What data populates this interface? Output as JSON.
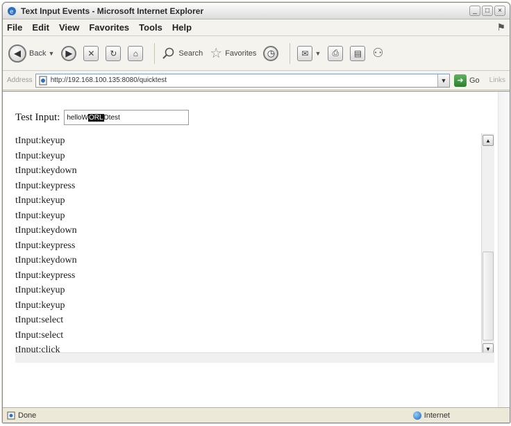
{
  "window": {
    "title": "Text Input Events - Microsoft Internet Explorer",
    "controls": [
      "_",
      "□",
      "×"
    ]
  },
  "menu": {
    "items": [
      "File",
      "Edit",
      "View",
      "Favorites",
      "Tools",
      "Help"
    ]
  },
  "toolbar": {
    "back_label": "Back",
    "search_label": "Search",
    "favorites_label": "Favorites",
    "icons": {
      "back": "back-arrow-icon",
      "forward": "forward-arrow-icon",
      "stop": "stop-icon",
      "refresh": "refresh-icon",
      "home": "home-icon",
      "search": "search-icon",
      "favorites": "star-icon",
      "history": "history-icon",
      "mail": "mail-icon",
      "print": "print-icon",
      "edit": "edit-icon",
      "messenger": "messenger-icon"
    }
  },
  "address": {
    "label": "Address",
    "url": "http://192.168.100.135:8080/quicktest",
    "go_label": "Go",
    "links_label": "Links"
  },
  "page": {
    "test_label": "Test Input:",
    "input_before": "helloW",
    "input_selected": "ORL",
    "input_after": "Dtest",
    "events": [
      "tInput:keyup",
      "tInput:keyup",
      "tInput:keydown",
      "tInput:keypress",
      "tInput:keyup",
      "tInput:keyup",
      "tInput:keydown",
      "tInput:keypress",
      "tInput:keydown",
      "tInput:keypress",
      "tInput:keyup",
      "tInput:keyup",
      "tInput:select",
      "tInput:select",
      "tInput:click"
    ]
  },
  "status": {
    "text": "Done",
    "zone": "Internet"
  },
  "colors": {
    "chrome_bg": "#ece9d8",
    "selection_bg": "#111111",
    "go_green": "#2e7d2e"
  }
}
